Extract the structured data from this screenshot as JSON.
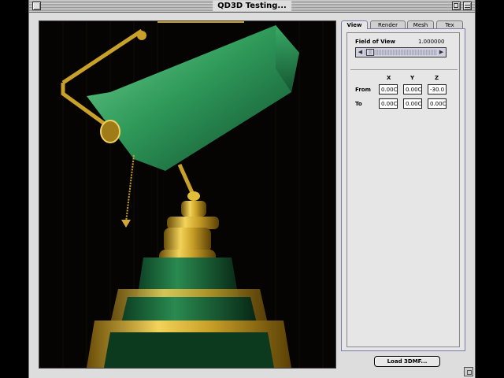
{
  "window": {
    "title": "QD3D Testing..."
  },
  "tabs": [
    {
      "label": "View",
      "active": true
    },
    {
      "label": "Render",
      "active": false
    },
    {
      "label": "Mesh",
      "active": false
    },
    {
      "label": "Tex",
      "active": false
    }
  ],
  "view_panel": {
    "fov_label": "Field of View",
    "fov_value": "1.000000",
    "columns": [
      "X",
      "Y",
      "Z"
    ],
    "rows": [
      {
        "label": "From",
        "values": [
          "0.00C",
          "0.00C",
          "-30.0"
        ]
      },
      {
        "label": "To",
        "values": [
          "0.00C",
          "0.00C",
          "0.00C"
        ]
      }
    ]
  },
  "load_button_label": "Load 3DMF...",
  "colors": {
    "lamp_shade": "#2f9a5a",
    "brass": "#c9a028",
    "viewport_bg": "#050403"
  }
}
